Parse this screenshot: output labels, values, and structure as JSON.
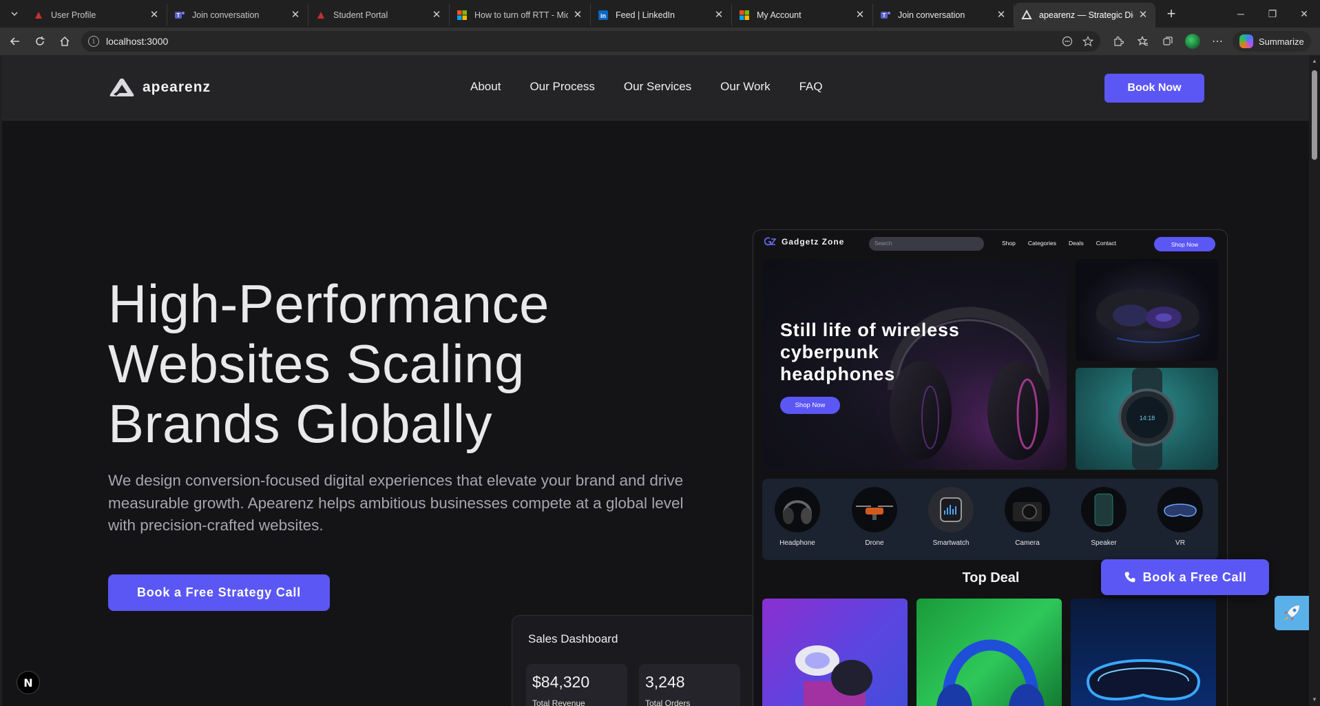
{
  "browser": {
    "tabs": [
      {
        "label": "User Profile",
        "icon": "red-triangle-icon",
        "active": false
      },
      {
        "label": "Join conversation",
        "icon": "teams-icon",
        "active": false
      },
      {
        "label": "Student Portal",
        "icon": "red-triangle-icon",
        "active": false
      },
      {
        "label": "How to turn off RTT - Micros",
        "icon": "microsoft-icon",
        "active": false
      },
      {
        "label": "Feed | LinkedIn",
        "icon": "linkedin-icon",
        "active": false
      },
      {
        "label": "My Account",
        "icon": "microsoft-icon",
        "active": false
      },
      {
        "label": "Join conversation",
        "icon": "teams-icon",
        "active": false
      },
      {
        "label": "apearenz — Strategic Digital",
        "icon": "apearenz-icon",
        "active": true
      }
    ],
    "new_tab": "+",
    "url": "localhost:3000",
    "summarize_label": "Summarize"
  },
  "site": {
    "brand": "apearenz",
    "nav": [
      "About",
      "Our Process",
      "Our Services",
      "Our Work",
      "FAQ"
    ],
    "book_now": "Book Now",
    "hero": {
      "title_lines": [
        "High-Performance",
        "Websites Scaling",
        "Brands Globally"
      ],
      "subtitle": "We design conversion-focused digital experiences that elevate your brand and drive measurable growth. Apearenz helps ambitious businesses compete at a global level with precision-crafted websites.",
      "cta": "Book a Free Strategy Call"
    },
    "dashboard": {
      "title": "Sales Dashboard",
      "stats": [
        {
          "value": "$84,320",
          "label": "Total Revenue"
        },
        {
          "value": "3,248",
          "label": "Total Orders"
        }
      ]
    },
    "mockup": {
      "brand": "Gadgetz Zone",
      "search_placeholder": "Search",
      "links": [
        "Shop",
        "Categories",
        "Deals",
        "Contact"
      ],
      "shop_now": "Shop Now",
      "hero_title": "Still life of wireless cyberpunk headphones",
      "hero_button": "Shop Now",
      "categories": [
        "Headphone",
        "Drone",
        "Smartwatch",
        "Camera",
        "Speaker",
        "VR"
      ],
      "top_deal": "Top Deal"
    },
    "floating_cta": "Book a Free Call",
    "colors": {
      "accent": "#5b57f5",
      "background": "#141416",
      "header": "#242427"
    }
  }
}
